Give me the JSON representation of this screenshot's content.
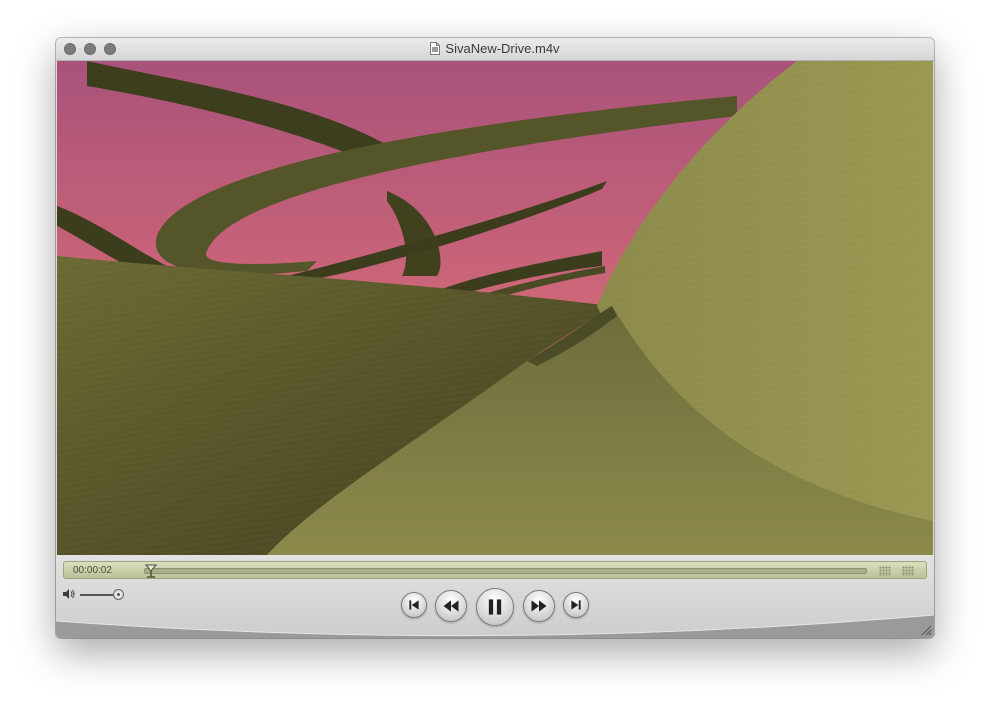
{
  "window": {
    "title": "SivaNew-Drive.m4v"
  },
  "player": {
    "current_time": "00:00:02",
    "progress": 0.01,
    "volume": 0.95,
    "state": "playing"
  },
  "icons": {
    "doc": "document-icon",
    "volume": "speaker-icon",
    "skip_back": "skip-to-start-icon",
    "rewind": "rewind-icon",
    "pause": "pause-icon",
    "fast_forward": "fast-forward-icon",
    "skip_forward": "skip-to-end-icon"
  },
  "colors": {
    "timeline_bg": "#c4cba4",
    "video_ground": "#7d7a40",
    "sky_top": "#b0587a",
    "sky_bottom": "#e58a6a"
  }
}
